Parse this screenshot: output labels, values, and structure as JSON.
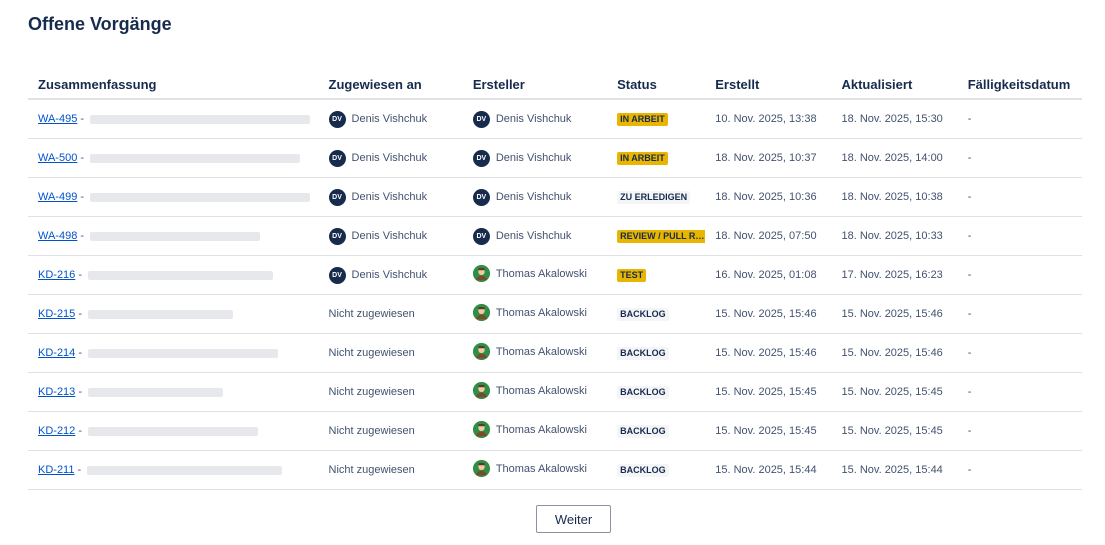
{
  "page": {
    "title": "Offene Vorgänge"
  },
  "table": {
    "headers": {
      "summary": "Zusammenfassung",
      "assignee": "Zugewiesen an",
      "creator": "Ersteller",
      "status": "Status",
      "created": "Erstellt",
      "updated": "Aktualisiert",
      "due": "Fälligkeitsdatum"
    },
    "rows": [
      {
        "key": "WA-495",
        "sep": " - ",
        "assignee": "Denis Vishchuk",
        "assignee_initials": "DV",
        "creator": "Denis Vishchuk",
        "creator_initials": "DV",
        "status": "IN ARBEIT",
        "created": "10. Nov. 2025, 13:38",
        "updated": "18. Nov. 2025, 15:30",
        "due": "-"
      },
      {
        "key": "WA-500",
        "sep": " - ",
        "assignee": "Denis Vishchuk",
        "assignee_initials": "DV",
        "creator": "Denis Vishchuk",
        "creator_initials": "DV",
        "status": "IN ARBEIT",
        "created": "18. Nov. 2025, 10:37",
        "updated": "18. Nov. 2025, 14:00",
        "due": "-"
      },
      {
        "key": "WA-499",
        "sep": " - ",
        "assignee": "Denis Vishchuk",
        "assignee_initials": "DV",
        "creator": "Denis Vishchuk",
        "creator_initials": "DV",
        "status": "ZU ERLEDIGEN",
        "created": "18. Nov. 2025, 10:36",
        "updated": "18. Nov. 2025, 10:38",
        "due": "-"
      },
      {
        "key": "WA-498",
        "sep": " - ",
        "assignee": "Denis Vishchuk",
        "assignee_initials": "DV",
        "creator": "Denis Vishchuk",
        "creator_initials": "DV",
        "status": "REVIEW / PULL REQUEST",
        "created": "18. Nov. 2025, 07:50",
        "updated": "18. Nov. 2025, 10:33",
        "due": "-"
      },
      {
        "key": "KD-216",
        "sep": " - ",
        "assignee": "Denis Vishchuk",
        "assignee_initials": "DV",
        "creator": "Thomas Akalowski",
        "creator_initials": "",
        "status": "TEST",
        "created": "16. Nov. 2025, 01:08",
        "updated": "17. Nov. 2025, 16:23",
        "due": "-"
      },
      {
        "key": "KD-215",
        "sep": " - ",
        "assignee": "Nicht zugewiesen",
        "assignee_initials": "",
        "creator": "Thomas Akalowski",
        "creator_initials": "",
        "status": "BACKLOG",
        "created": "15. Nov. 2025, 15:46",
        "updated": "15. Nov. 2025, 15:46",
        "due": "-"
      },
      {
        "key": "KD-214",
        "sep": " - ",
        "assignee": "Nicht zugewiesen",
        "assignee_initials": "",
        "creator": "Thomas Akalowski",
        "creator_initials": "",
        "status": "BACKLOG",
        "created": "15. Nov. 2025, 15:46",
        "updated": "15. Nov. 2025, 15:46",
        "due": "-"
      },
      {
        "key": "KD-213",
        "sep": " - ",
        "assignee": "Nicht zugewiesen",
        "assignee_initials": "",
        "creator": "Thomas Akalowski",
        "creator_initials": "",
        "status": "BACKLOG",
        "created": "15. Nov. 2025, 15:45",
        "updated": "15. Nov. 2025, 15:45",
        "due": "-"
      },
      {
        "key": "KD-212",
        "sep": " - ",
        "assignee": "Nicht zugewiesen",
        "assignee_initials": "",
        "creator": "Thomas Akalowski",
        "creator_initials": "",
        "status": "BACKLOG",
        "created": "15. Nov. 2025, 15:45",
        "updated": "15. Nov. 2025, 15:45",
        "due": "-"
      },
      {
        "key": "KD-211",
        "sep": " - ",
        "assignee": "Nicht zugewiesen",
        "assignee_initials": "",
        "creator": "Thomas Akalowski",
        "creator_initials": "",
        "status": "BACKLOG",
        "created": "15. Nov. 2025, 15:44",
        "updated": "15. Nov. 2025, 15:44",
        "due": "-"
      }
    ]
  },
  "pagination": {
    "next_label": "Weiter"
  },
  "colors": {
    "link": "#0052cc",
    "lozenge_yellow": "#e8b500",
    "lozenge_gray": "#f4f5f7",
    "avatar_dark": "#172b4d",
    "avatar_photo": "#2f8f46"
  }
}
